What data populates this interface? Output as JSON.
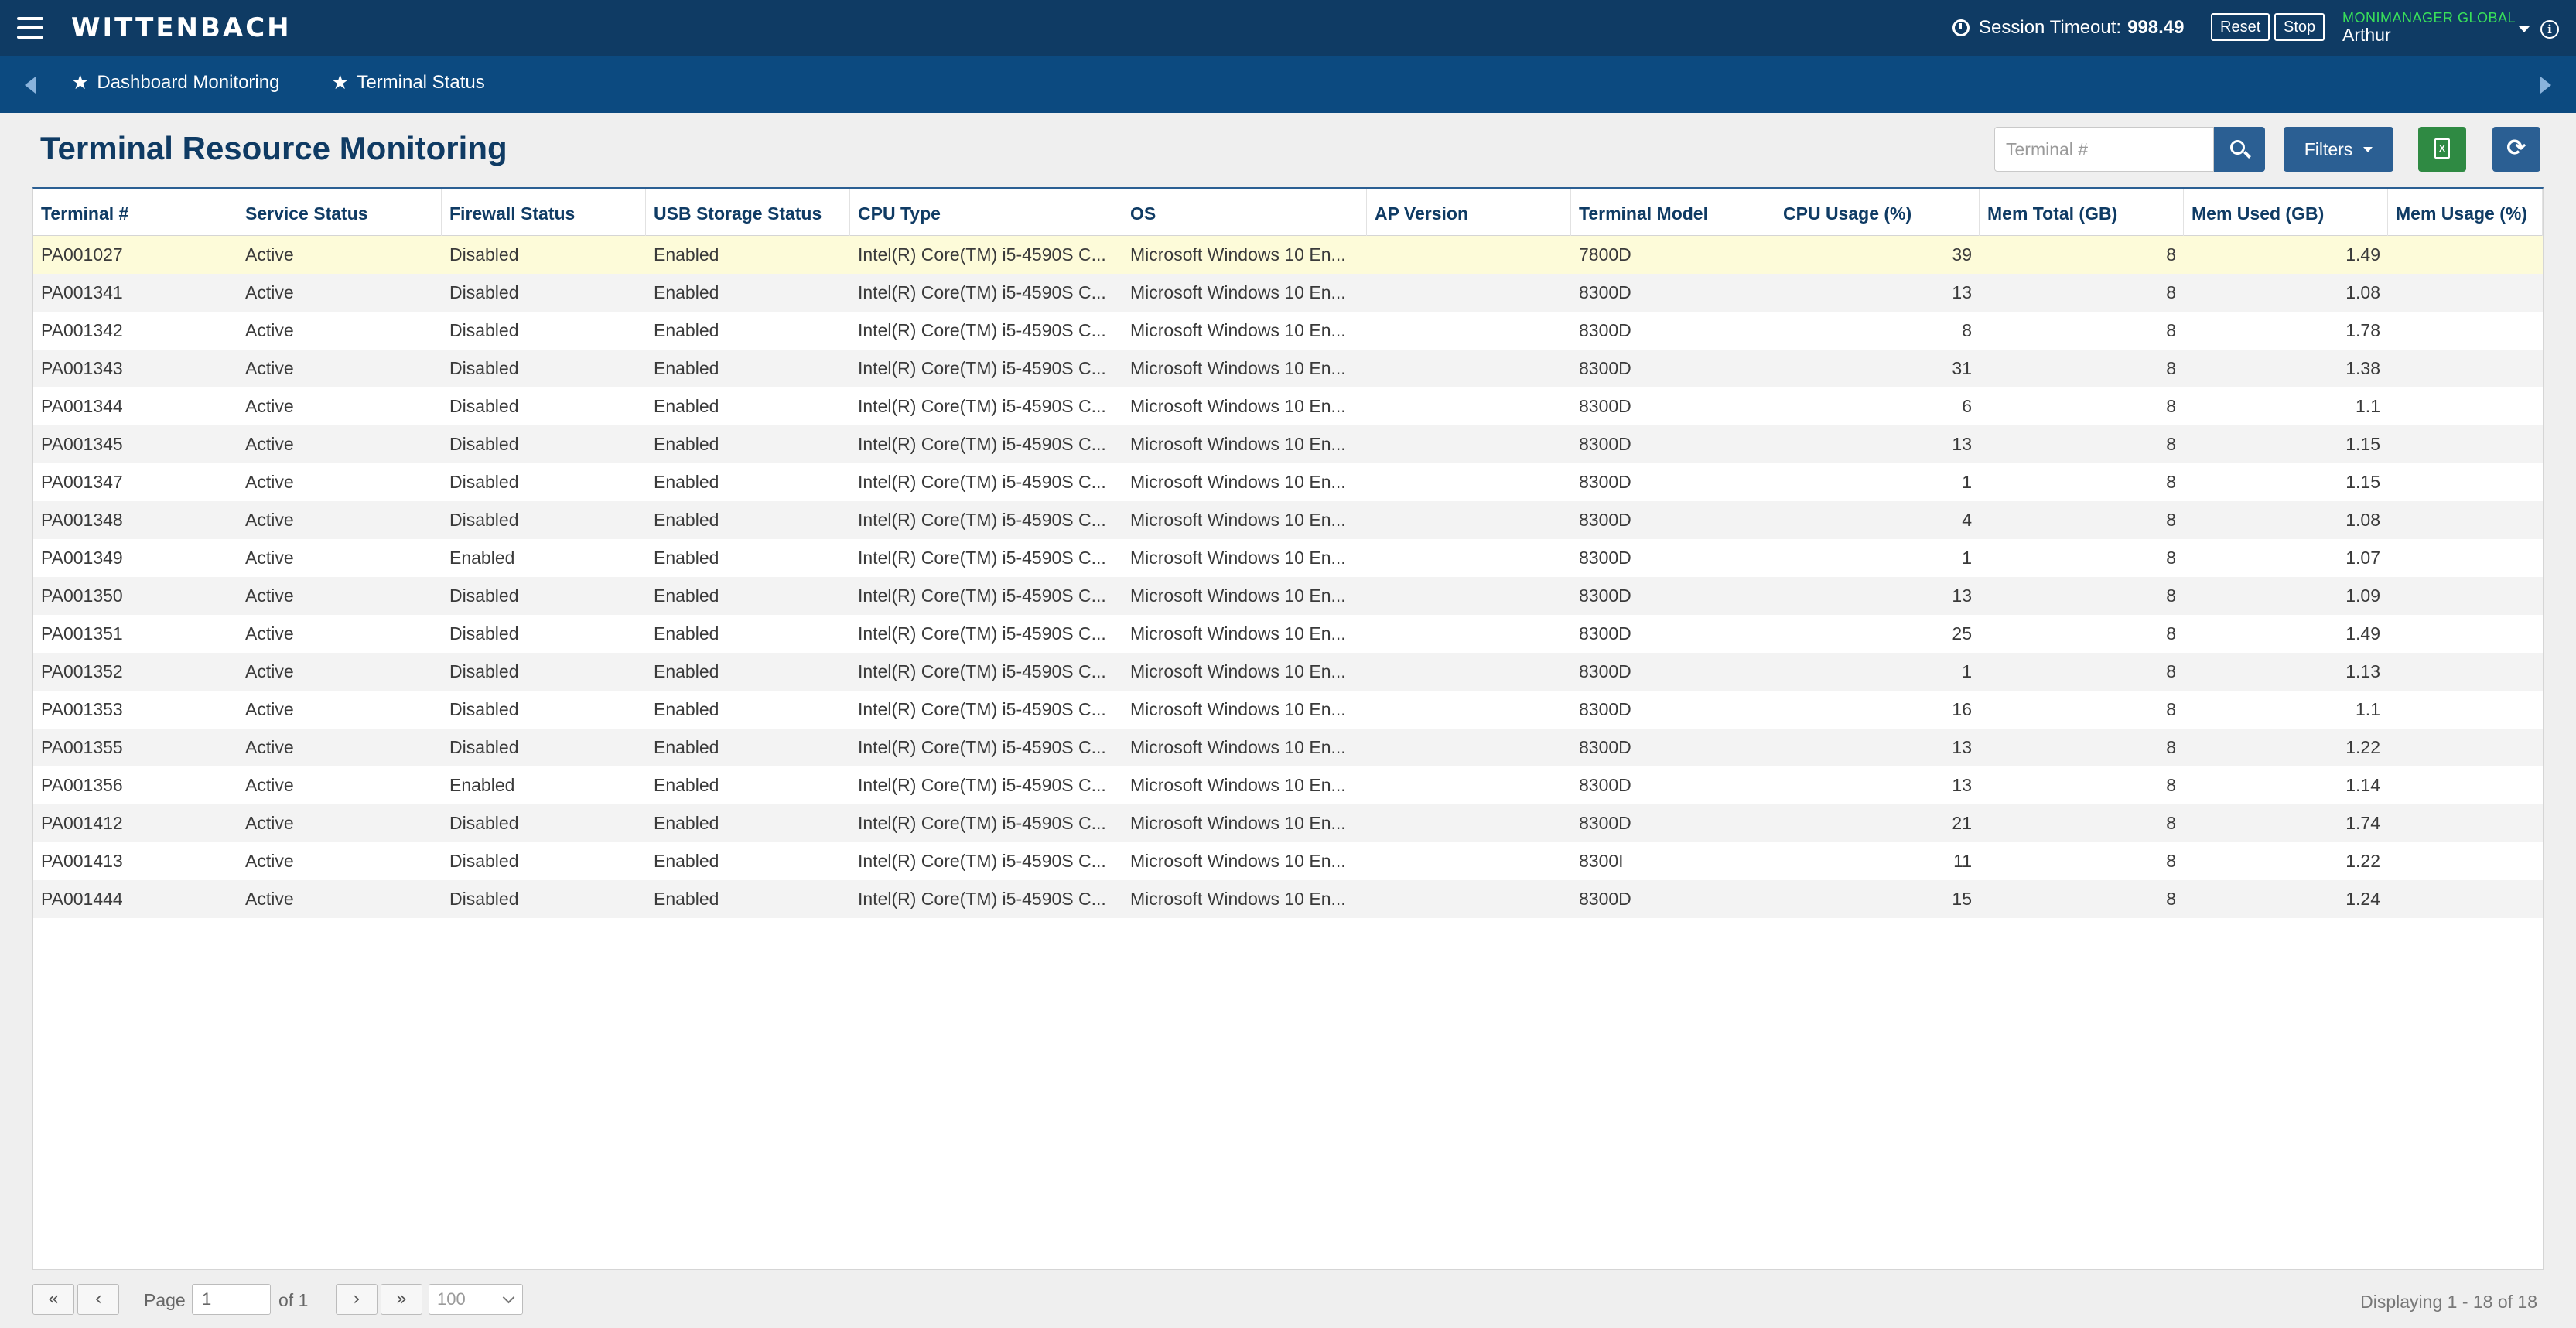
{
  "app": {
    "logo": "WITTENBACH",
    "session_label": "Session Timeout:",
    "session_value": "998.49",
    "reset_label": "Reset",
    "stop_label": "Stop",
    "user_role": "MONIMANAGER GLOBAL",
    "user_name": "Arthur",
    "info_glyph": "i"
  },
  "nav": {
    "items": [
      {
        "label": "Dashboard Monitoring",
        "icon": "star-icon"
      },
      {
        "label": "Terminal Status",
        "icon": "star-icon"
      }
    ]
  },
  "page": {
    "title": "Terminal Resource Monitoring",
    "search_placeholder": "Terminal #",
    "filters_label": "Filters",
    "excel_glyph": "X",
    "refresh_glyph": "⟳"
  },
  "columns": [
    "Terminal #",
    "Service Status",
    "Firewall Status",
    "USB Storage Status",
    "CPU Type",
    "OS",
    "AP Version",
    "Terminal Model",
    "CPU Usage (%)",
    "Mem Total (GB)",
    "Mem Used (GB)",
    "Mem Usage (%)"
  ],
  "rows": [
    [
      "PA001027",
      "Active",
      "Disabled",
      "Enabled",
      "Intel(R) Core(TM) i5-4590S C...",
      "Microsoft Windows 10 En...",
      "",
      "7800D",
      "39",
      "8",
      "1.49",
      ""
    ],
    [
      "PA001341",
      "Active",
      "Disabled",
      "Enabled",
      "Intel(R) Core(TM) i5-4590S C...",
      "Microsoft Windows 10 En...",
      "",
      "8300D",
      "13",
      "8",
      "1.08",
      ""
    ],
    [
      "PA001342",
      "Active",
      "Disabled",
      "Enabled",
      "Intel(R) Core(TM) i5-4590S C...",
      "Microsoft Windows 10 En...",
      "",
      "8300D",
      "8",
      "8",
      "1.78",
      ""
    ],
    [
      "PA001343",
      "Active",
      "Disabled",
      "Enabled",
      "Intel(R) Core(TM) i5-4590S C...",
      "Microsoft Windows 10 En...",
      "",
      "8300D",
      "31",
      "8",
      "1.38",
      ""
    ],
    [
      "PA001344",
      "Active",
      "Disabled",
      "Enabled",
      "Intel(R) Core(TM) i5-4590S C...",
      "Microsoft Windows 10 En...",
      "",
      "8300D",
      "6",
      "8",
      "1.1",
      ""
    ],
    [
      "PA001345",
      "Active",
      "Disabled",
      "Enabled",
      "Intel(R) Core(TM) i5-4590S C...",
      "Microsoft Windows 10 En...",
      "",
      "8300D",
      "13",
      "8",
      "1.15",
      ""
    ],
    [
      "PA001347",
      "Active",
      "Disabled",
      "Enabled",
      "Intel(R) Core(TM) i5-4590S C...",
      "Microsoft Windows 10 En...",
      "",
      "8300D",
      "1",
      "8",
      "1.15",
      ""
    ],
    [
      "PA001348",
      "Active",
      "Disabled",
      "Enabled",
      "Intel(R) Core(TM) i5-4590S C...",
      "Microsoft Windows 10 En...",
      "",
      "8300D",
      "4",
      "8",
      "1.08",
      ""
    ],
    [
      "PA001349",
      "Active",
      "Enabled",
      "Enabled",
      "Intel(R) Core(TM) i5-4590S C...",
      "Microsoft Windows 10 En...",
      "",
      "8300D",
      "1",
      "8",
      "1.07",
      ""
    ],
    [
      "PA001350",
      "Active",
      "Disabled",
      "Enabled",
      "Intel(R) Core(TM) i5-4590S C...",
      "Microsoft Windows 10 En...",
      "",
      "8300D",
      "13",
      "8",
      "1.09",
      ""
    ],
    [
      "PA001351",
      "Active",
      "Disabled",
      "Enabled",
      "Intel(R) Core(TM) i5-4590S C...",
      "Microsoft Windows 10 En...",
      "",
      "8300D",
      "25",
      "8",
      "1.49",
      ""
    ],
    [
      "PA001352",
      "Active",
      "Disabled",
      "Enabled",
      "Intel(R) Core(TM) i5-4590S C...",
      "Microsoft Windows 10 En...",
      "",
      "8300D",
      "1",
      "8",
      "1.13",
      ""
    ],
    [
      "PA001353",
      "Active",
      "Disabled",
      "Enabled",
      "Intel(R) Core(TM) i5-4590S C...",
      "Microsoft Windows 10 En...",
      "",
      "8300D",
      "16",
      "8",
      "1.1",
      ""
    ],
    [
      "PA001355",
      "Active",
      "Disabled",
      "Enabled",
      "Intel(R) Core(TM) i5-4590S C...",
      "Microsoft Windows 10 En...",
      "",
      "8300D",
      "13",
      "8",
      "1.22",
      ""
    ],
    [
      "PA001356",
      "Active",
      "Enabled",
      "Enabled",
      "Intel(R) Core(TM) i5-4590S C...",
      "Microsoft Windows 10 En...",
      "",
      "8300D",
      "13",
      "8",
      "1.14",
      ""
    ],
    [
      "PA001412",
      "Active",
      "Disabled",
      "Enabled",
      "Intel(R) Core(TM) i5-4590S C...",
      "Microsoft Windows 10 En...",
      "",
      "8300D",
      "21",
      "8",
      "1.74",
      ""
    ],
    [
      "PA001413",
      "Active",
      "Disabled",
      "Enabled",
      "Intel(R) Core(TM) i5-4590S C...",
      "Microsoft Windows 10 En...",
      "",
      "8300I",
      "11",
      "8",
      "1.22",
      ""
    ],
    [
      "PA001444",
      "Active",
      "Disabled",
      "Enabled",
      "Intel(R) Core(TM) i5-4590S C...",
      "Microsoft Windows 10 En...",
      "",
      "8300D",
      "15",
      "8",
      "1.24",
      ""
    ]
  ],
  "pager": {
    "first_glyph": "«",
    "prev_glyph": "‹",
    "next_glyph": "›",
    "last_glyph": "»",
    "page_label": "Page",
    "page_value": "1",
    "of_label": "of 1",
    "page_size": "100",
    "display_text": "Displaying 1 - 18 of 18"
  }
}
